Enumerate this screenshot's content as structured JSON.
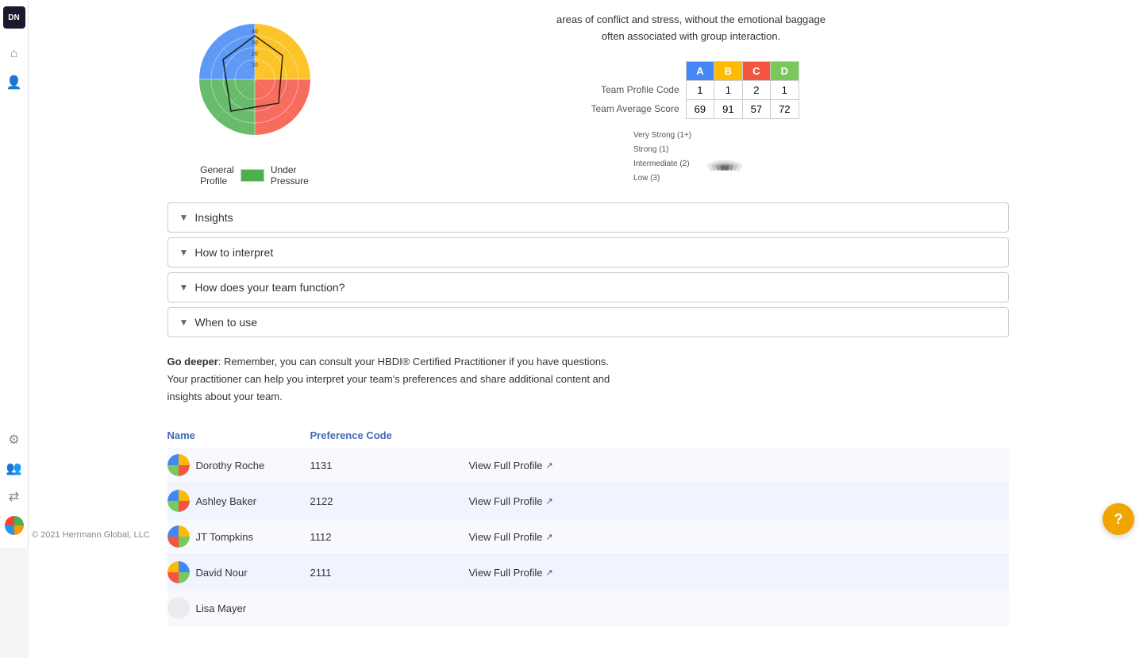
{
  "sidebar": {
    "logo": "DN",
    "icons": [
      {
        "name": "home-icon",
        "symbol": "⌂"
      },
      {
        "name": "person-icon",
        "symbol": "👤"
      }
    ],
    "bottom_icons": [
      {
        "name": "settings-icon",
        "symbol": "⚙"
      },
      {
        "name": "team-icon",
        "symbol": "👥"
      },
      {
        "name": "transfer-icon",
        "symbol": "⇄"
      }
    ]
  },
  "info_text": "areas of conflict and stress, without the emotional baggage often associated with group interaction.",
  "profile_table": {
    "headers": [
      "A",
      "B",
      "C",
      "D"
    ],
    "rows": [
      {
        "label": "Team Profile Code",
        "values": [
          "1",
          "1",
          "2",
          "1"
        ]
      },
      {
        "label": "Team Average Score",
        "values": [
          "69",
          "91",
          "57",
          "72"
        ]
      }
    ]
  },
  "strength_legend": {
    "labels": [
      "Very Strong (1+)",
      "Strong (1)",
      "Intermediate (2)",
      "Low (3)"
    ]
  },
  "chart_legend": {
    "general_label": "General",
    "general_sublabel": "Profile",
    "under_label": "Under",
    "under_sublabel": "Pressure"
  },
  "accordion": {
    "items": [
      {
        "label": "Insights"
      },
      {
        "label": "How to interpret"
      },
      {
        "label": "How does your team function?"
      },
      {
        "label": "When to use"
      }
    ]
  },
  "go_deeper": {
    "bold_part": "Go deeper",
    "text": ": Remember, you can consult your HBDI® Certified Practitioner if you have questions. Your practitioner can help you interpret your team's preferences and share additional content and insights about your team."
  },
  "team_table": {
    "col_name": "Name",
    "col_pref": "Preference Code",
    "members": [
      {
        "name": "Dorothy Roche",
        "pref_code": "1131",
        "view_label": "View Full Profile",
        "avatar_colors": [
          "#4287f5",
          "#fcba03",
          "#f55442",
          "#78c95a"
        ]
      },
      {
        "name": "Ashley Baker",
        "pref_code": "2122",
        "view_label": "View Full Profile",
        "avatar_colors": [
          "#4287f5",
          "#fcba03",
          "#f55442",
          "#78c95a"
        ]
      },
      {
        "name": "JT Tompkins",
        "pref_code": "1112",
        "view_label": "View Full Profile",
        "avatar_colors": [
          "#4287f5",
          "#fcba03",
          "#78c95a",
          "#f55442"
        ]
      },
      {
        "name": "David Nour",
        "pref_code": "2111",
        "view_label": "View Full Profile",
        "avatar_colors": [
          "#fcba03",
          "#4287f5",
          "#78c95a",
          "#f55442"
        ]
      },
      {
        "name": "Lisa Mayer",
        "pref_code": "",
        "view_label": "",
        "avatar_colors": [
          "#cccccc",
          "#dddddd",
          "#bbbbbb",
          "#eeeeee"
        ]
      }
    ]
  },
  "footer": {
    "text": "© 2021 Herrmann Global, LLC"
  },
  "help_button": "?"
}
